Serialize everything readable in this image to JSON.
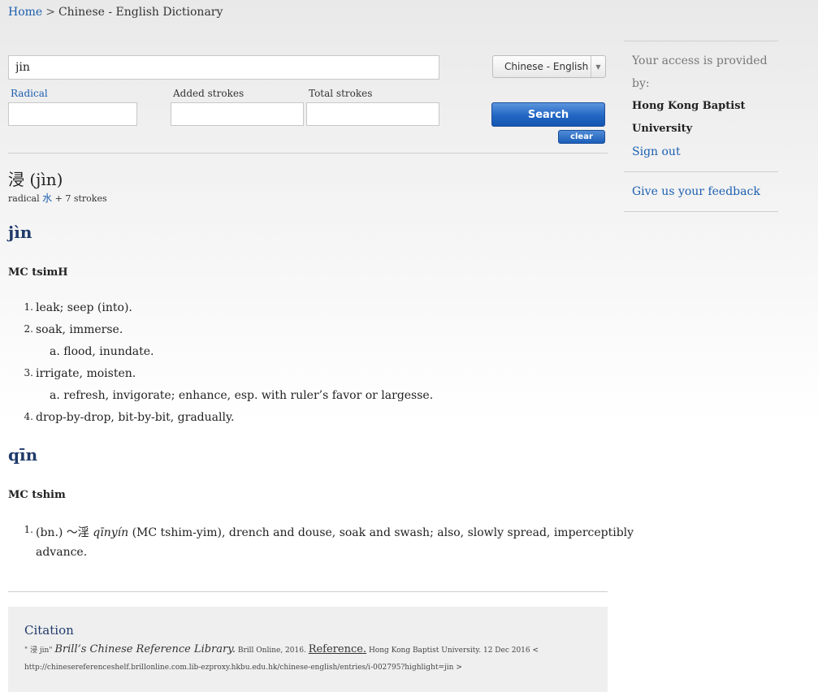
{
  "breadcrumb": {
    "home": "Home",
    "separator": ">",
    "current": "Chinese - English Dictionary"
  },
  "search": {
    "query": "jin",
    "language": "Chinese - English",
    "radical_label": "Radical",
    "added_strokes_label": "Added strokes",
    "total_strokes_label": "Total strokes",
    "search_button": "Search",
    "clear_button": "clear"
  },
  "entry": {
    "headword": "浸 (jìn)",
    "radical_prefix": "radical",
    "radical_char": "水",
    "radical_suffix": "+ 7 strokes"
  },
  "readings": [
    {
      "pinyin": "jìn",
      "mc": "MC tsimH",
      "definitions": [
        {
          "num": "1.",
          "text": "leak; seep (into)."
        },
        {
          "num": "2.",
          "text": "soak, immerse."
        },
        {
          "sub": "a. flood, inundate."
        },
        {
          "num": "3.",
          "text": "irrigate, moisten."
        },
        {
          "sub": "a. refresh, invigorate; enhance, esp. with ruler’s favor or largesse."
        },
        {
          "num": "4.",
          "text": "drop-by-drop, bit-by-bit, gradually."
        }
      ]
    },
    {
      "pinyin": "qīn",
      "mc": "MC tshim",
      "definitions": [
        {
          "num": "1.",
          "text_a": "(bn.) ～淫",
          "text_italic": "qīnyín",
          "text_b": "(MC tshim-yim), drench and douse, soak and swash; also, slowly spread, imperceptibly",
          "text_c": "advance."
        }
      ]
    }
  ],
  "citation": {
    "title": "Citation",
    "prefix": "\" 浸 jin\"",
    "library": "Brill’s Chinese Reference Library.",
    "publisher": "Brill Online, 2016.",
    "reference": "Reference.",
    "access": "Hong Kong Baptist University. 12 Dec 2016 <",
    "url": "http://chinesereferenceshelf.brillonline.com.lib-ezproxy.hkbu.edu.hk/chinese-english/entries/i-002795?highlight=jin >"
  },
  "sidebar": {
    "access_text_1": "Your access is provided",
    "access_text_2": "by:",
    "institution_1": "Hong Kong Baptist",
    "institution_2": "University",
    "sign_out": "Sign out",
    "feedback": "Give us your feedback"
  }
}
